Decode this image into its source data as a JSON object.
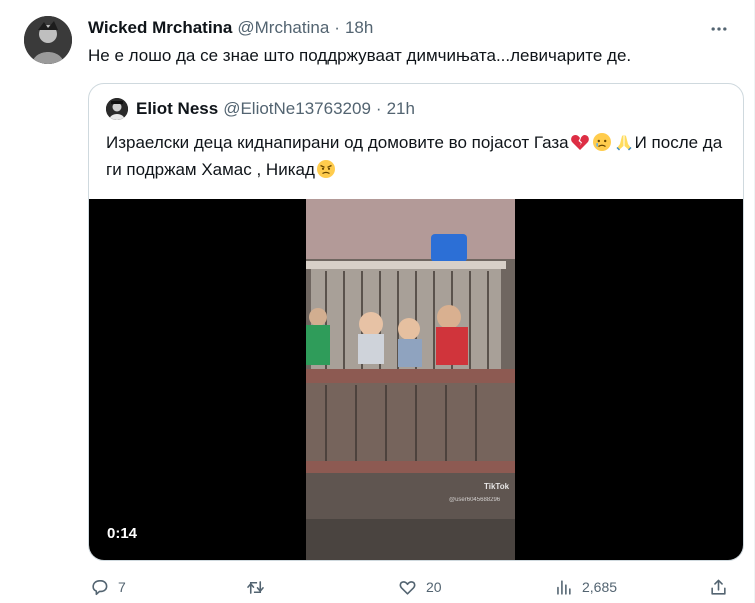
{
  "tweet": {
    "author_name": "Wicked Mrchatina",
    "author_handle": "@Mrchatina",
    "separator": "·",
    "time": "18h",
    "text": "Не е лошо да се знае што поддржуваат димчињата...левичарите де.",
    "more_icon": "more-horizontal-icon"
  },
  "quote": {
    "author_name": "Eliot Ness",
    "author_handle": "@EliotNe13763209",
    "separator": "·",
    "time": "21h",
    "text_part1": "Израелски деца киднапирани од домовите во појасот Газа",
    "text_part2": "И после да ги подржам Хамас  , Никад",
    "emojis": [
      "broken-heart-emoji",
      "sad-relieved-face-emoji",
      "folded-hands-emoji",
      "angry-face-emoji"
    ],
    "video": {
      "duration": "0:14",
      "watermark": "TikTok",
      "watermark_user": "@user6045688296"
    }
  },
  "actions": {
    "replies": "7",
    "retweets": "",
    "likes": "20",
    "views": "2,685"
  },
  "colors": {
    "text_primary": "#0f1419",
    "text_secondary": "#536471",
    "border": "#cfd9de",
    "video_bg": "#000000"
  }
}
